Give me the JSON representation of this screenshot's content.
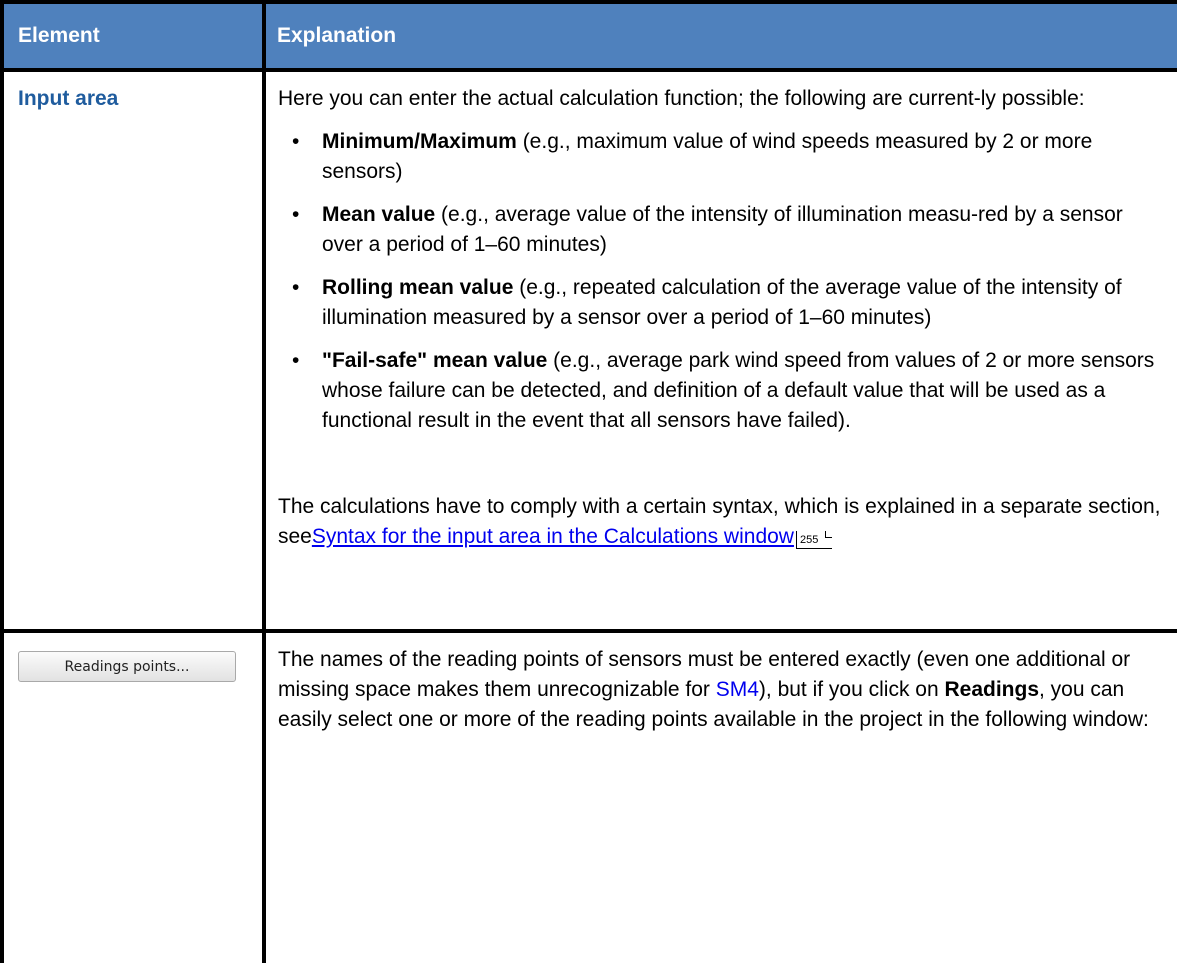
{
  "table": {
    "headers": {
      "element": "Element",
      "explanation": "Explanation"
    },
    "rows": [
      {
        "element": "Input area",
        "intro": "Here you can enter the actual calculation function; the following are current-ly possible:",
        "bullets": [
          {
            "bold": "Minimum/Maximum",
            "text": " (e.g., maximum value of wind speeds measured by 2 or more sensors)"
          },
          {
            "bold": "Mean value",
            "text": " (e.g., average value of the intensity of illumination measu-red by a sensor over a period of 1–60 minutes)"
          },
          {
            "bold": "Rolling mean value",
            "text": " (e.g., repeated calculation of the average value of the intensity of illumination measured by a sensor over a period of 1–60 minutes)"
          },
          {
            "bold": "\"Fail-safe\" mean value",
            "text": " (e.g., average park wind speed from values of 2 or more sensors whose failure can be detected, and definition of a default value that will be used as a functional result in the event that all sensors have failed)."
          }
        ],
        "syntax_text": "The calculations have to comply with a certain syntax, which is explained in a separate section, see",
        "syntax_link": "Syntax for the input area in the Calculations window",
        "page_ref": "255"
      },
      {
        "button_label": "Readings points...",
        "text_part1": "The names of the reading points of sensors must be entered exactly (even one additional or missing space makes them unrecognizable for ",
        "sm4_link": "SM4",
        "text_part2": "), but if you click on ",
        "bold_word": "Readings",
        "text_part3": ", you can easily select one or more of the reading points available in the project in the following window:"
      }
    ]
  }
}
